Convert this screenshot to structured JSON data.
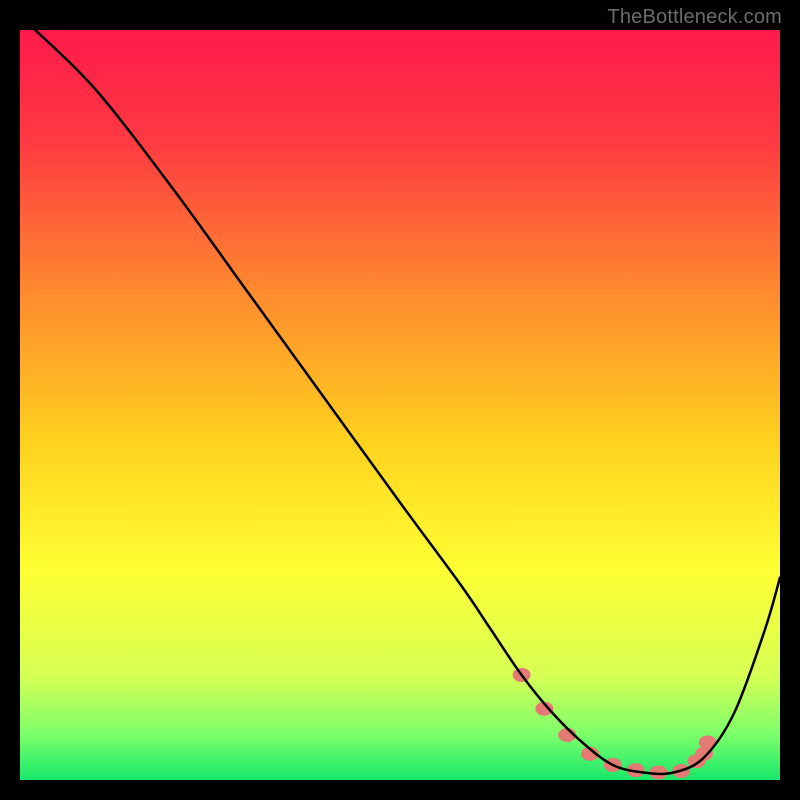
{
  "watermark": "TheBottleneck.com",
  "chart_data": {
    "type": "line",
    "title": "",
    "xlabel": "",
    "ylabel": "",
    "xlim": [
      0,
      100
    ],
    "ylim": [
      0,
      100
    ],
    "grid": false,
    "legend": false,
    "annotations": [],
    "curve": {
      "name": "bottleneck-curve",
      "x": [
        2,
        10,
        20,
        30,
        40,
        50,
        58,
        62,
        66,
        70,
        74,
        78,
        82,
        86,
        90,
        94,
        98,
        100
      ],
      "y": [
        100,
        92,
        79,
        65,
        51,
        37,
        26,
        20,
        14,
        9,
        5,
        2,
        1,
        1,
        3,
        9,
        20,
        27
      ]
    },
    "optimal_cluster": {
      "name": "optimal-range-dots",
      "x": [
        66,
        69,
        72,
        75,
        78,
        81,
        84,
        87,
        89,
        90,
        90.5
      ],
      "y": [
        14,
        9.5,
        6,
        3.5,
        2,
        1.3,
        1,
        1.2,
        2.5,
        3.5,
        5
      ]
    },
    "gradient_stops": [
      {
        "offset": 0.0,
        "color": "#ff1a4b"
      },
      {
        "offset": 0.15,
        "color": "#ff3a42"
      },
      {
        "offset": 0.35,
        "color": "#ff8a2e"
      },
      {
        "offset": 0.55,
        "color": "#ffd21e"
      },
      {
        "offset": 0.72,
        "color": "#ffff33"
      },
      {
        "offset": 0.86,
        "color": "#d7ff54"
      },
      {
        "offset": 0.94,
        "color": "#7bff6a"
      },
      {
        "offset": 1.0,
        "color": "#17e86a"
      }
    ],
    "dot_color": "#e47a73",
    "curve_color": "#000000"
  }
}
